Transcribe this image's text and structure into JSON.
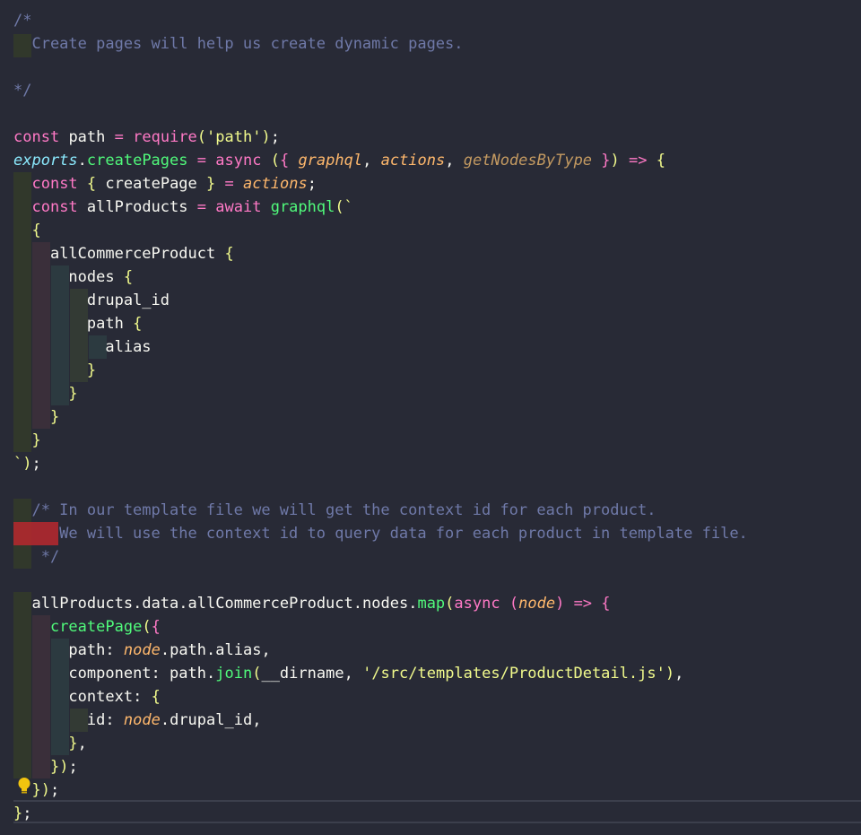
{
  "editor": {
    "lines": [
      "/*",
      "  Create pages will help us create dynamic pages.",
      "",
      "*/",
      "",
      "const path = require('path');",
      "exports.createPages = async ({ graphql, actions, getNodesByType }) => {",
      "  const { createPage } = actions;",
      "  const allProducts = await graphql(`",
      "  {",
      "    allCommerceProduct {",
      "      nodes {",
      "        drupal_id",
      "        path {",
      "          alias",
      "        }",
      "      }",
      "    }",
      "  }",
      "`);",
      "",
      "  /* In our template file we will get the context id for each product.",
      "     We will use the context id to query data for each product in template file.",
      "   */",
      "",
      "  allProducts.data.allCommerceProduct.nodes.map(async (node) => {",
      "    createPage({",
      "      path: node.path.alias,",
      "      component: path.join(__dirname, '/src/templates/ProductDetail.js'),",
      "      context: {",
      "        id: node.drupal_id,",
      "      },",
      "    });",
      "  });",
      "};"
    ],
    "lightbulb_icon": "lightbulb-icon",
    "colors": {
      "background": "#282a36",
      "keyword": "#ff79c6",
      "function": "#50fa7b",
      "string": "#f1fa8c",
      "comment": "#6f79a8",
      "parameter": "#ffb86c",
      "error_marker": "#b8282e"
    }
  }
}
